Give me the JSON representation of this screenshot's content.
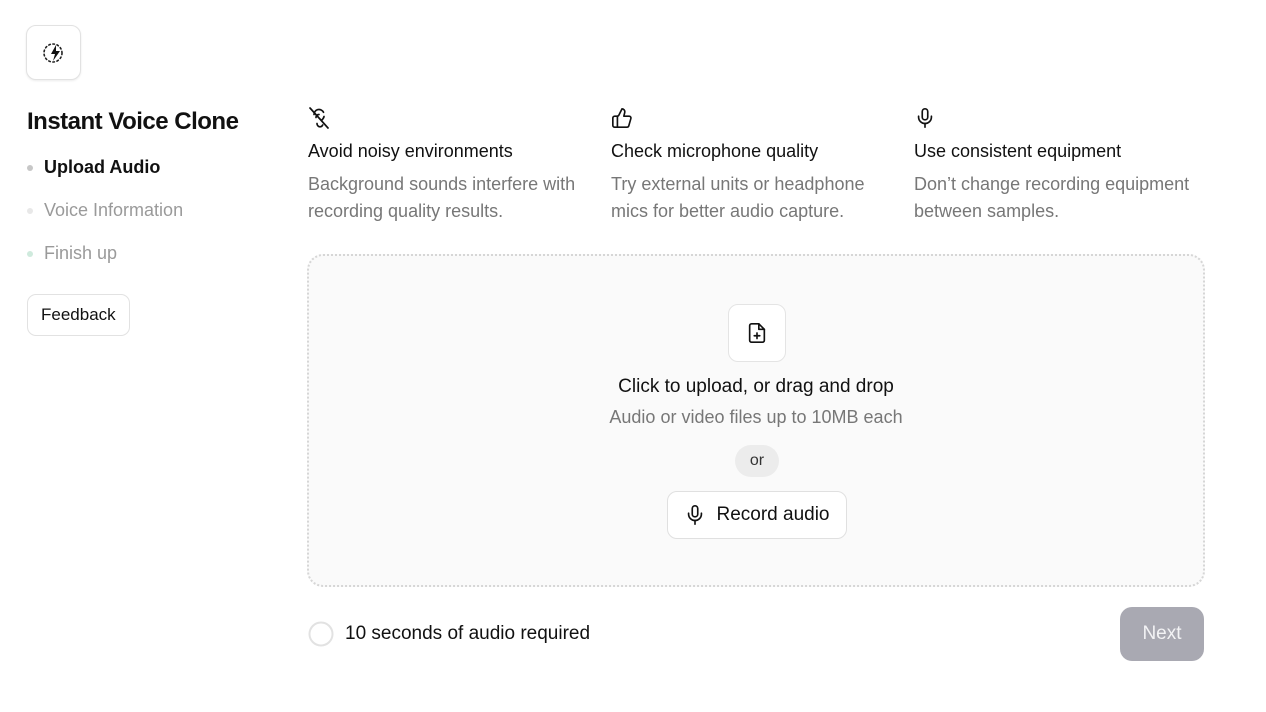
{
  "app": {
    "logo_icon": "loading-bolt-icon",
    "title": "Instant Voice Clone"
  },
  "sidebar": {
    "steps": [
      {
        "label": "Upload Audio",
        "state": "active"
      },
      {
        "label": "Voice Information",
        "state": "inactive"
      },
      {
        "label": "Finish up",
        "state": "inactive"
      }
    ],
    "feedback_label": "Feedback"
  },
  "tips": [
    {
      "icon": "ear-off-icon",
      "title": "Avoid noisy environments",
      "description": "Background sounds interfere with recording quality results."
    },
    {
      "icon": "thumbs-up-icon",
      "title": "Check microphone quality",
      "description": "Try external units or headphone mics for better audio capture."
    },
    {
      "icon": "mic-icon",
      "title": "Use consistent equipment",
      "description": "Don’t change recording equipment between samples."
    }
  ],
  "upload": {
    "icon": "file-plus-icon",
    "title": "Click to upload, or drag and drop",
    "subtitle": "Audio or video files up to 10MB each",
    "or_label": "or",
    "record_label": "Record audio",
    "record_icon": "mic-icon"
  },
  "footer": {
    "requirement_text": "10 seconds of audio required",
    "progress_fraction": 0,
    "next_label": "Next"
  },
  "colors": {
    "next_disabled_bg": "#a9a9b2",
    "step_done_dot": "#cfeadd"
  }
}
